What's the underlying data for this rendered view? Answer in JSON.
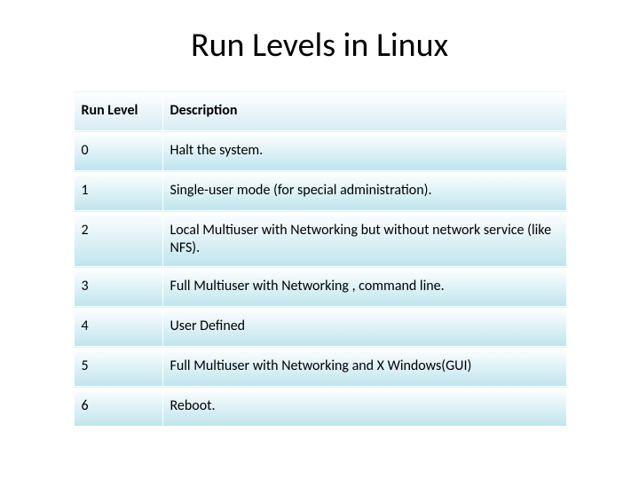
{
  "title": "Run Levels in Linux",
  "headers": {
    "col1": "Run Level",
    "col2": "Description"
  },
  "rows": [
    {
      "level": "0",
      "desc": "Halt the system."
    },
    {
      "level": "1",
      "desc": "Single-user mode (for special administration)."
    },
    {
      "level": "2",
      "desc": "Local Multiuser with Networking but without network service (like NFS)."
    },
    {
      "level": "3",
      "desc": "Full Multiuser with Networking ,  command line."
    },
    {
      "level": "4",
      "desc": "User Defined"
    },
    {
      "level": "5",
      "desc": "Full Multiuser with Networking and X Windows(GUI)"
    },
    {
      "level": "6",
      "desc": "Reboot."
    }
  ]
}
